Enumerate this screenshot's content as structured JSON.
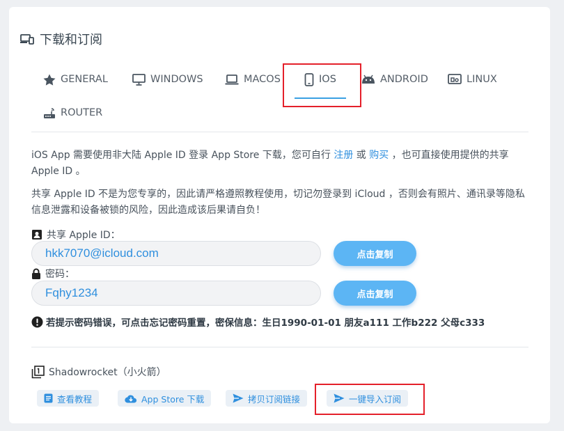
{
  "section_title": "下载和订阅",
  "tabs": [
    {
      "label": "GENERAL",
      "icon": "star-icon"
    },
    {
      "label": "WINDOWS",
      "icon": "monitor-icon"
    },
    {
      "label": "MACOS",
      "icon": "laptop-icon"
    },
    {
      "label": "IOS",
      "icon": "phone-icon",
      "active": true
    },
    {
      "label": "ANDROID",
      "icon": "android-icon"
    },
    {
      "label": "LINUX",
      "icon": "linux-icon"
    },
    {
      "label": "ROUTER",
      "icon": "router-icon"
    }
  ],
  "intro": {
    "part1": "iOS App 需要使用非大陆 Apple ID 登录 App Store 下载，您可自行 ",
    "register_link": "注册",
    "or": " 或 ",
    "buy_link": "购买",
    "part2": " ，也可直接使用提供的共享 Apple ID 。"
  },
  "notice": "共享 Apple ID 不是为您专享的，因此请严格遵照教程使用，切记勿登录到 iCloud ，否则会有照片、通讯录等隐私信息泄露和设备被锁的风险，因此造成该后果请自负！",
  "account": {
    "id_label": "共享 Apple ID：",
    "id_value": "hkk7070@icloud.com",
    "password_label": "密码：",
    "password_value": "Fqhy1234",
    "copy_label": "点击复制"
  },
  "warning": "若提示密码错误，可点击忘记密码重置，密保信息：生日1990-01-01 朋友a111 工作b222 父母c333",
  "app": {
    "name": "Shadowrocket（小火箭）",
    "actions": {
      "tutorial": "查看教程",
      "appstore": "App Store 下载",
      "copy_link": "拷贝订阅链接",
      "import": "一键导入订阅"
    }
  },
  "colors": {
    "accent": "#2f8fde",
    "button": "#5cb5f4",
    "highlight": "#e4202a"
  }
}
